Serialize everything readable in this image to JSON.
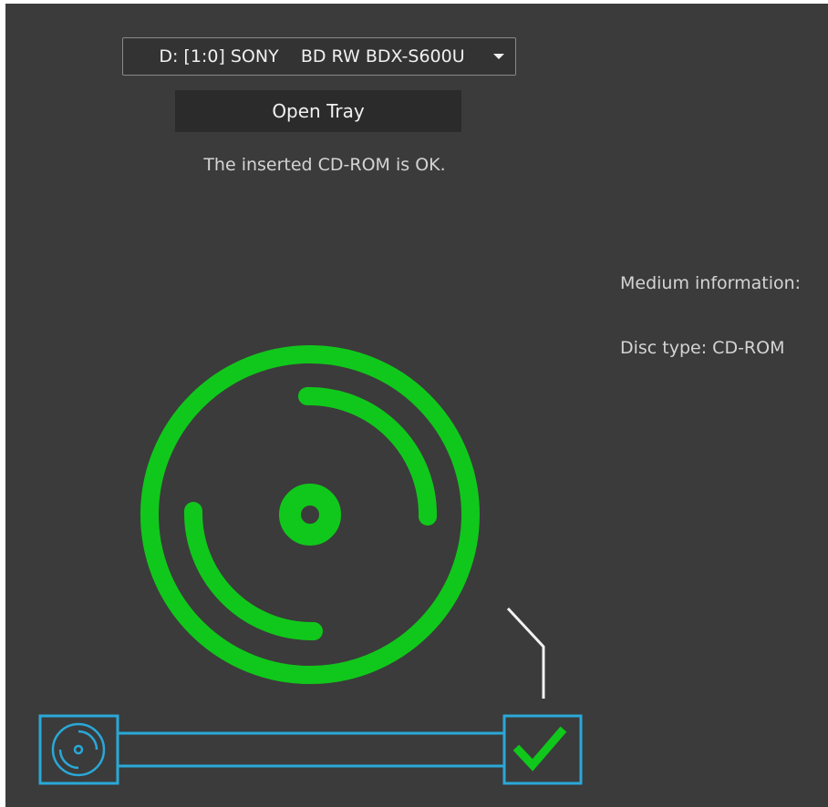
{
  "drive_selector": {
    "value": "D: [1:0] SONY    BD RW BDX-S600U"
  },
  "buttons": {
    "open_tray": "Open Tray"
  },
  "status": {
    "message": "The inserted CD-ROM is OK."
  },
  "medium": {
    "heading": "Medium information:",
    "disc_type": "Disc type: CD-ROM"
  },
  "icons": {
    "large_disc": "disc-icon",
    "small_disc": "disc-icon",
    "result": "checkmark-icon"
  },
  "colors": {
    "background": "#3b3b3b",
    "disc_ok": "#10c81b",
    "progress_accent": "#2aa8d8",
    "pointer_line": "#f2f2f2"
  },
  "progress": {
    "complete": 1
  }
}
